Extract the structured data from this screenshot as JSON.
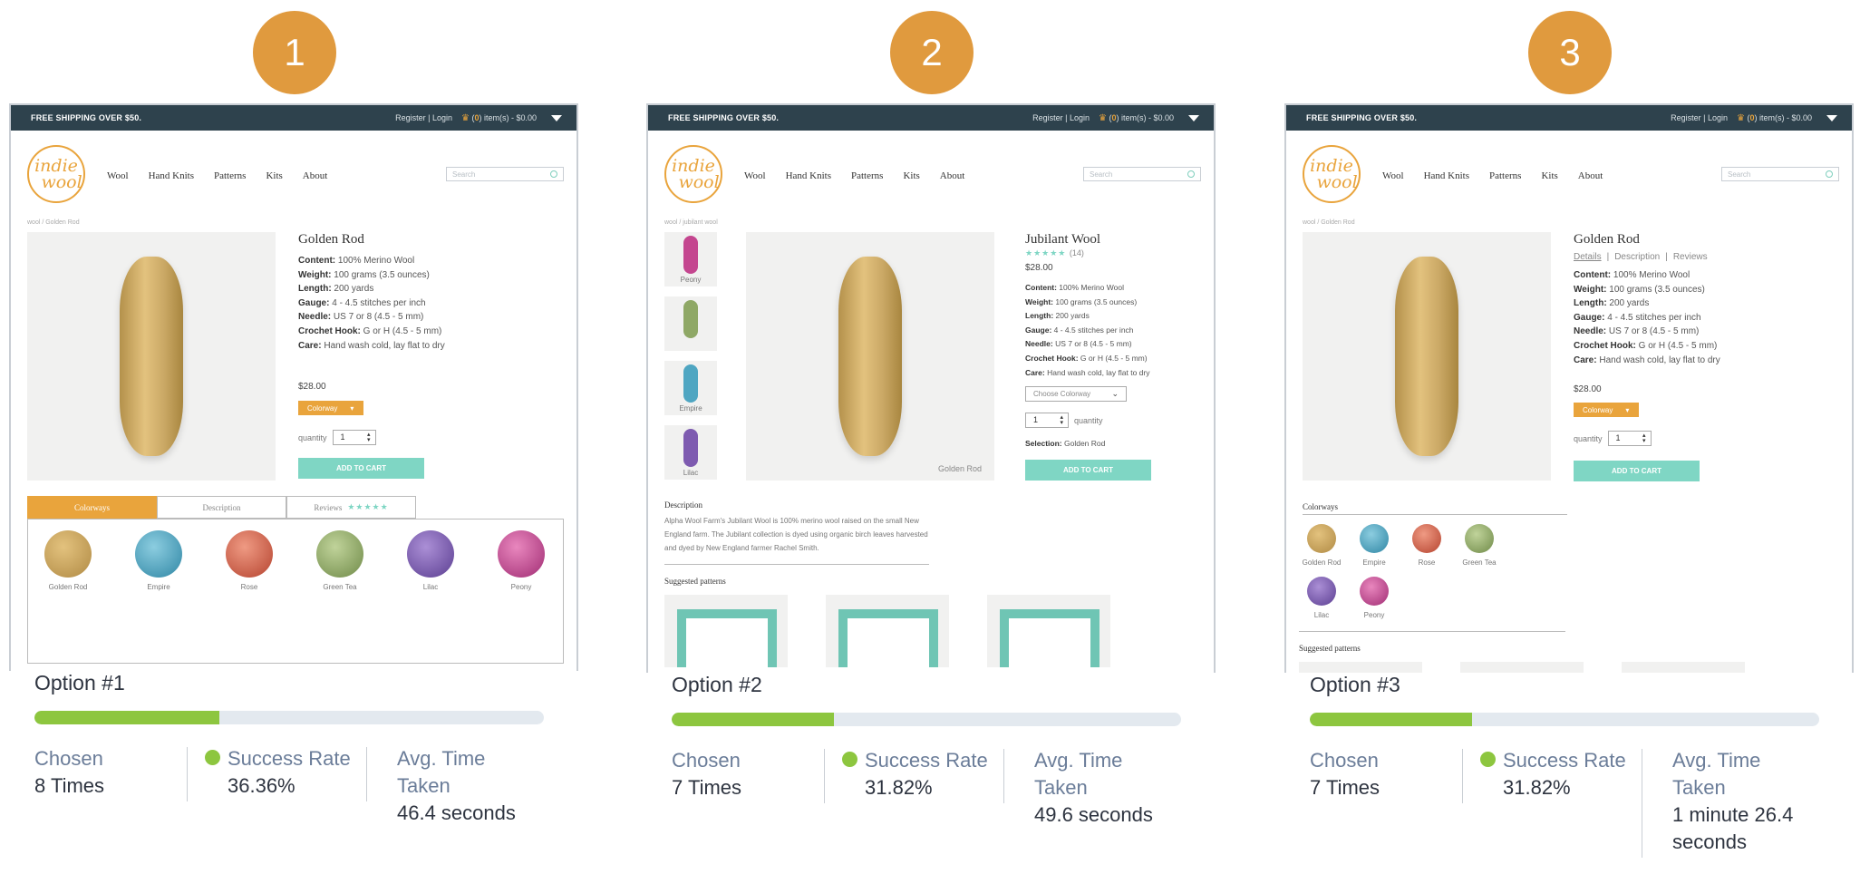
{
  "options": [
    {
      "number": "1",
      "site": {
        "topbar": {
          "shipping": "FREE SHIPPING OVER $50.",
          "auth": "Register | Login",
          "cart_prefix": "(",
          "cart_count": "0",
          "cart_suffix": ") item(s) - $0.00"
        },
        "logo": {
          "line1": "indie",
          "line2": "wool"
        },
        "nav": [
          "Wool",
          "Hand Knits",
          "Patterns",
          "Kits",
          "About"
        ],
        "search_placeholder": "Search",
        "breadcrumb": "wool / Golden Rod",
        "product_title": "Golden Rod",
        "specs": [
          {
            "k": "Content:",
            "v": " 100% Merino Wool"
          },
          {
            "k": "Weight:",
            "v": " 100 grams (3.5 ounces)"
          },
          {
            "k": "Length:",
            "v": " 200 yards"
          },
          {
            "k": "Gauge:",
            "v": " 4 - 4.5 stitches per inch"
          },
          {
            "k": "Needle:",
            "v": " US 7 or 8 (4.5 - 5 mm)"
          },
          {
            "k": "Crochet Hook:",
            "v": " G or H (4.5 - 5 mm)"
          },
          {
            "k": "Care:",
            "v": " Hand wash cold, lay flat to dry"
          }
        ],
        "price": "$28.00",
        "colorway_button": "Colorway",
        "quantity_label": "quantity",
        "quantity_value": "1",
        "add_to_cart": "ADD TO CART",
        "tabs": [
          "Colorways",
          "Description",
          "Reviews"
        ],
        "review_stars": "★★★★★",
        "swatches": [
          "Golden Rod",
          "Empire",
          "Rose",
          "Green Tea",
          "Lilac",
          "Peony"
        ]
      },
      "stats": {
        "title": "Option #1",
        "progress": 0.3636,
        "chosen_label": "Chosen",
        "chosen_value": "8 Times",
        "success_label": "Success Rate",
        "success_value": "36.36%",
        "time_label_1": "Avg. Time",
        "time_label_2": "Taken",
        "time_value_1": "46.4 seconds",
        "time_value_2": ""
      }
    },
    {
      "number": "2",
      "site": {
        "topbar": {
          "shipping": "FREE SHIPPING OVER $50.",
          "auth": "Register | Login",
          "cart_prefix": "(",
          "cart_count": "0",
          "cart_suffix": ") item(s) - $0.00"
        },
        "logo": {
          "line1": "indie",
          "line2": "wool"
        },
        "nav": [
          "Wool",
          "Hand Knits",
          "Patterns",
          "Kits",
          "About"
        ],
        "search_placeholder": "Search",
        "breadcrumb": "wool / jubilant wool",
        "thumbs": [
          "Peony",
          "",
          "Empire",
          "Lilac"
        ],
        "image_caption": "Golden Rod",
        "product_title": "Jubilant Wool",
        "stars": "★★★★★",
        "review_count": "(14)",
        "price": "$28.00",
        "specs": [
          {
            "k": "Content:",
            "v": " 100% Merino Wool"
          },
          {
            "k": "Weight:",
            "v": " 100 grams (3.5 ounces)"
          },
          {
            "k": "Length:",
            "v": " 200 yards"
          },
          {
            "k": "Gauge:",
            "v": " 4 - 4.5 stitches per inch"
          },
          {
            "k": "Needle:",
            "v": " US 7 or 8 (4.5 - 5 mm)"
          },
          {
            "k": "Crochet Hook:",
            "v": " G or H (4.5 - 5 mm)"
          },
          {
            "k": "Care:",
            "v": " Hand wash cold, lay flat to dry"
          }
        ],
        "select_placeholder": "Choose Colorway",
        "quantity_label": "quantity",
        "quantity_value": "1",
        "selection_label": "Selection:",
        "selection_value": " Golden Rod",
        "add_to_cart": "ADD TO CART",
        "description_heading": "Description",
        "description_lines": [
          "Alpha Wool Farm's Jubilant Wool is 100% merino wool raised on the small New",
          "England farm. The Jubilant collection is dyed using organic birch leaves harvested",
          "and dyed by New England farmer Rachel Smith."
        ],
        "patterns_heading": "Suggested patterns"
      },
      "stats": {
        "title": "Option #2",
        "progress": 0.3182,
        "chosen_label": "Chosen",
        "chosen_value": "7 Times",
        "success_label": "Success Rate",
        "success_value": "31.82%",
        "time_label_1": "Avg. Time",
        "time_label_2": "Taken",
        "time_value_1": "49.6 seconds",
        "time_value_2": ""
      }
    },
    {
      "number": "3",
      "site": {
        "topbar": {
          "shipping": "FREE SHIPPING OVER $50.",
          "auth": "Register | Login",
          "cart_prefix": "(",
          "cart_count": "0",
          "cart_suffix": ") item(s) - $0.00"
        },
        "logo": {
          "line1": "indie",
          "line2": "wool"
        },
        "nav": [
          "Wool",
          "Hand Knits",
          "Patterns",
          "Kits",
          "About"
        ],
        "search_placeholder": "Search",
        "breadcrumb": "wool / Golden Rod",
        "product_title": "Golden Rod",
        "sub_tabs": [
          "Details",
          "Description",
          "Reviews"
        ],
        "specs": [
          {
            "k": "Content:",
            "v": " 100% Merino Wool"
          },
          {
            "k": "Weight:",
            "v": " 100 grams (3.5 ounces)"
          },
          {
            "k": "Length:",
            "v": " 200 yards"
          },
          {
            "k": "Gauge:",
            "v": " 4 - 4.5 stitches per inch"
          },
          {
            "k": "Needle:",
            "v": " US 7 or 8 (4.5 - 5 mm)"
          },
          {
            "k": "Crochet Hook:",
            "v": " G or H (4.5 - 5 mm)"
          },
          {
            "k": "Care:",
            "v": " Hand wash cold, lay flat to dry"
          }
        ],
        "price": "$28.00",
        "colorway_button": "Colorway",
        "quantity_label": "quantity",
        "quantity_value": "1",
        "add_to_cart": "ADD TO CART",
        "colorways_heading": "Colorways",
        "swatches": [
          "Golden Rod",
          "Empire",
          "Rose",
          "Green Tea",
          "Lilac",
          "Peony"
        ],
        "patterns_heading": "Suggested patterns"
      },
      "stats": {
        "title": "Option #3",
        "progress": 0.3182,
        "chosen_label": "Chosen",
        "chosen_value": "7 Times",
        "success_label": "Success Rate",
        "success_value": "31.82%",
        "time_label_1": "Avg. Time",
        "time_label_2": "Taken",
        "time_value_1": "1 minute 26.4",
        "time_value_2": "seconds"
      }
    }
  ],
  "colors": {
    "badge": "#e09a3e",
    "accent_orange": "#e9a43c",
    "accent_teal": "#7fd6c4",
    "topbar": "#2e424d",
    "success_green": "#8dc63f",
    "golden_rod": "#c9a25a",
    "empire": "#4fa6c2",
    "rose": "#d2604f",
    "green_tea": "#8fa866",
    "lilac": "#7e5bb0",
    "peony": "#c4468f"
  }
}
